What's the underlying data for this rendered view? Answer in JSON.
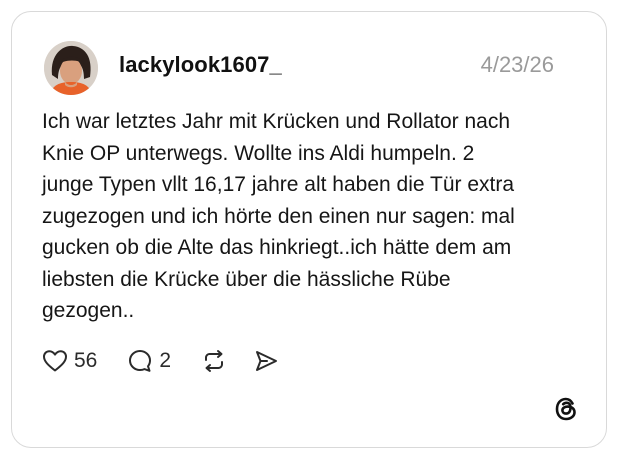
{
  "post": {
    "username": "lackylook1607_",
    "date": "4/23/26",
    "text": "Ich war letztes Jahr mit Krücken und Rollator nach\nKnie OP unterwegs. Wollte ins Aldi humpeln. 2\njunge Typen vllt 16,17 jahre alt haben die Tür extra\nzugezogen und ich hörte den einen nur sagen: mal\ngucken ob die Alte das hinkriegt..ich hätte dem am\nliebsten die Krücke über die hässliche Rübe\ngezogen..",
    "likes": "56",
    "replies": "2"
  },
  "icons": {
    "like": "heart-icon",
    "reply": "comment-icon",
    "repost": "repost-icon",
    "share": "send-icon",
    "brand": "threads-logo-icon"
  },
  "colors": {
    "card_border": "#d9d9d9",
    "date_text": "#9a9a9a",
    "text": "#161616"
  }
}
